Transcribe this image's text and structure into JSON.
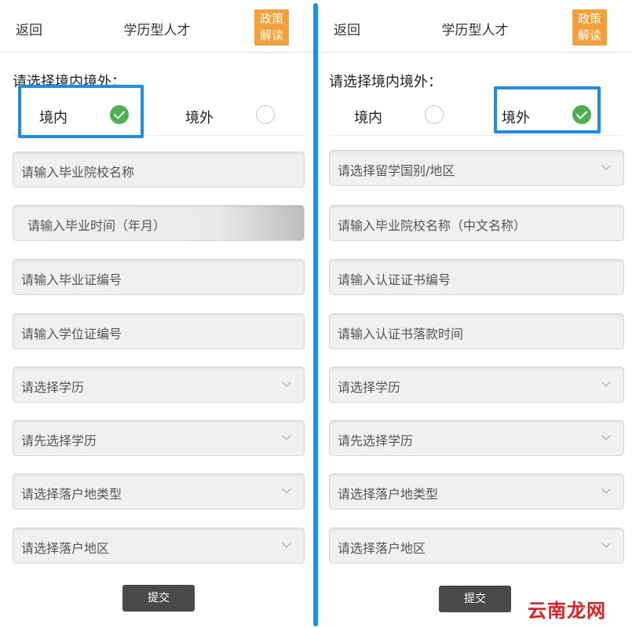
{
  "left": {
    "header": {
      "back": "返回",
      "title": "学历型人才",
      "policy_line1": "政策",
      "policy_line2": "解读"
    },
    "prompt": "请选择境内境外：",
    "options": [
      {
        "label": "境内",
        "checked": true
      },
      {
        "label": "境外",
        "checked": false
      }
    ],
    "fields": [
      {
        "placeholder": "请输入毕业院校名称",
        "type": "input"
      },
      {
        "placeholder": "请输入毕业时间（年月）",
        "type": "input"
      },
      {
        "placeholder": "请输入毕业证编号",
        "type": "input"
      },
      {
        "placeholder": "请输入学位证编号",
        "type": "input"
      },
      {
        "placeholder": "请选择学历",
        "type": "select"
      },
      {
        "placeholder": "请先选择学历",
        "type": "select"
      },
      {
        "placeholder": "请选择落户地类型",
        "type": "select"
      },
      {
        "placeholder": "请选择落户地区",
        "type": "select"
      }
    ],
    "submit": "提交"
  },
  "right": {
    "header": {
      "back": "返回",
      "title": "学历型人才",
      "policy_line1": "政策",
      "policy_line2": "解读"
    },
    "prompt": "请选择境内境外：",
    "options": [
      {
        "label": "境内",
        "checked": false
      },
      {
        "label": "境外",
        "checked": true
      }
    ],
    "fields": [
      {
        "placeholder": "请选择留学国别/地区",
        "type": "select"
      },
      {
        "placeholder": "请输入毕业院校名称（中文名称）",
        "type": "input"
      },
      {
        "placeholder": "请输入认证证书编号",
        "type": "input"
      },
      {
        "placeholder": "请输入认证书落款时间",
        "type": "input"
      },
      {
        "placeholder": "请选择学历",
        "type": "select"
      },
      {
        "placeholder": "请先选择学历",
        "type": "select"
      },
      {
        "placeholder": "请选择落户地类型",
        "type": "select"
      },
      {
        "placeholder": "请选择落户地区",
        "type": "select"
      }
    ],
    "submit": "提交"
  },
  "watermark": "云南龙网",
  "colors": {
    "highlight": "#1a8fe3",
    "policy": "#f2a13a",
    "check": "#4cb050",
    "submit": "#4a4a4a",
    "watermark": "#e02020"
  }
}
